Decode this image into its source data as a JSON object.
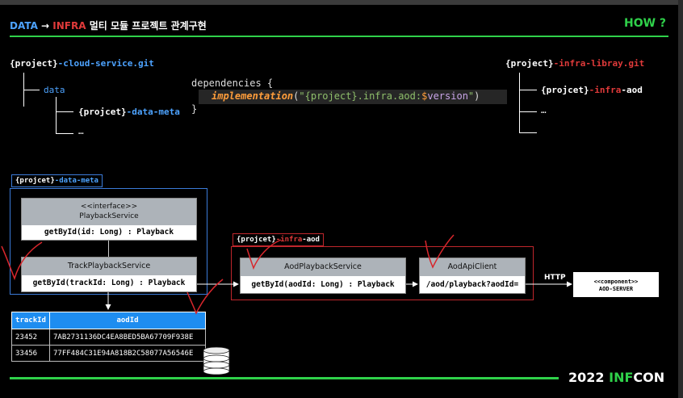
{
  "header": {
    "title_data": "DATA",
    "title_arrow": "→",
    "title_infra": "INFRA",
    "title_rest": "멀티 모듈 프로젝트 관계구현",
    "how": "HOW ?"
  },
  "footer": {
    "year": "2022",
    "inf": "INF",
    "con": "CON"
  },
  "left_repo": {
    "prefix": "{project}",
    "suffix": "-cloud-service.git",
    "child": "data",
    "grandchild_prefix": "{projcet}",
    "grandchild_suffix": "-data-meta",
    "ellipsis": "…"
  },
  "right_repo": {
    "prefix": "{project}",
    "suffix": "-infra-libray.git",
    "child_prefix": "{projcet}",
    "child_mid": "-infra",
    "child_suffix": "-aod",
    "ellipsis": "…"
  },
  "code": {
    "line1": "dependencies {",
    "keyword": "implementation",
    "open": "(",
    "string_start": "\"{project}.infra.aod:",
    "dollar": "$",
    "var": "version",
    "string_end": "\"",
    "close": ")",
    "line3": "}"
  },
  "data_meta_box": {
    "label_prefix": "{projcet}",
    "label_suffix": "-data-meta",
    "interface_stereotype": "<<interface>>",
    "interface_name": "PlaybackService",
    "interface_method": "getById(id: Long) : Playback",
    "impl_name": "TrackPlaybackService",
    "impl_method": "getById(trackId: Long) : Playback"
  },
  "infra_box": {
    "label_prefix": "{projcet}",
    "label_mid": "-infra",
    "label_suffix": "-aod",
    "service_name": "AodPlaybackService",
    "service_method": "getById(aodId: Long) : Playback",
    "client_name": "AodApiClient",
    "client_method": "/aod/playback?aodId="
  },
  "http_label": "HTTP",
  "server": {
    "stereotype": "<<component>>",
    "name": "AOD-SERVER"
  },
  "table": {
    "headers": [
      "trackId",
      "aodId"
    ],
    "rows": [
      [
        "23452",
        "7AB2731136DC4EA8BED5BA67709F938E"
      ],
      [
        "33456",
        "77FF484C31E94A818B2C58077A56546E"
      ]
    ]
  },
  "colors": {
    "accent_green": "#2fd14a",
    "data_blue": "#4da3ff",
    "infra_red": "#e03a3a",
    "table_header": "#1e8df0"
  }
}
